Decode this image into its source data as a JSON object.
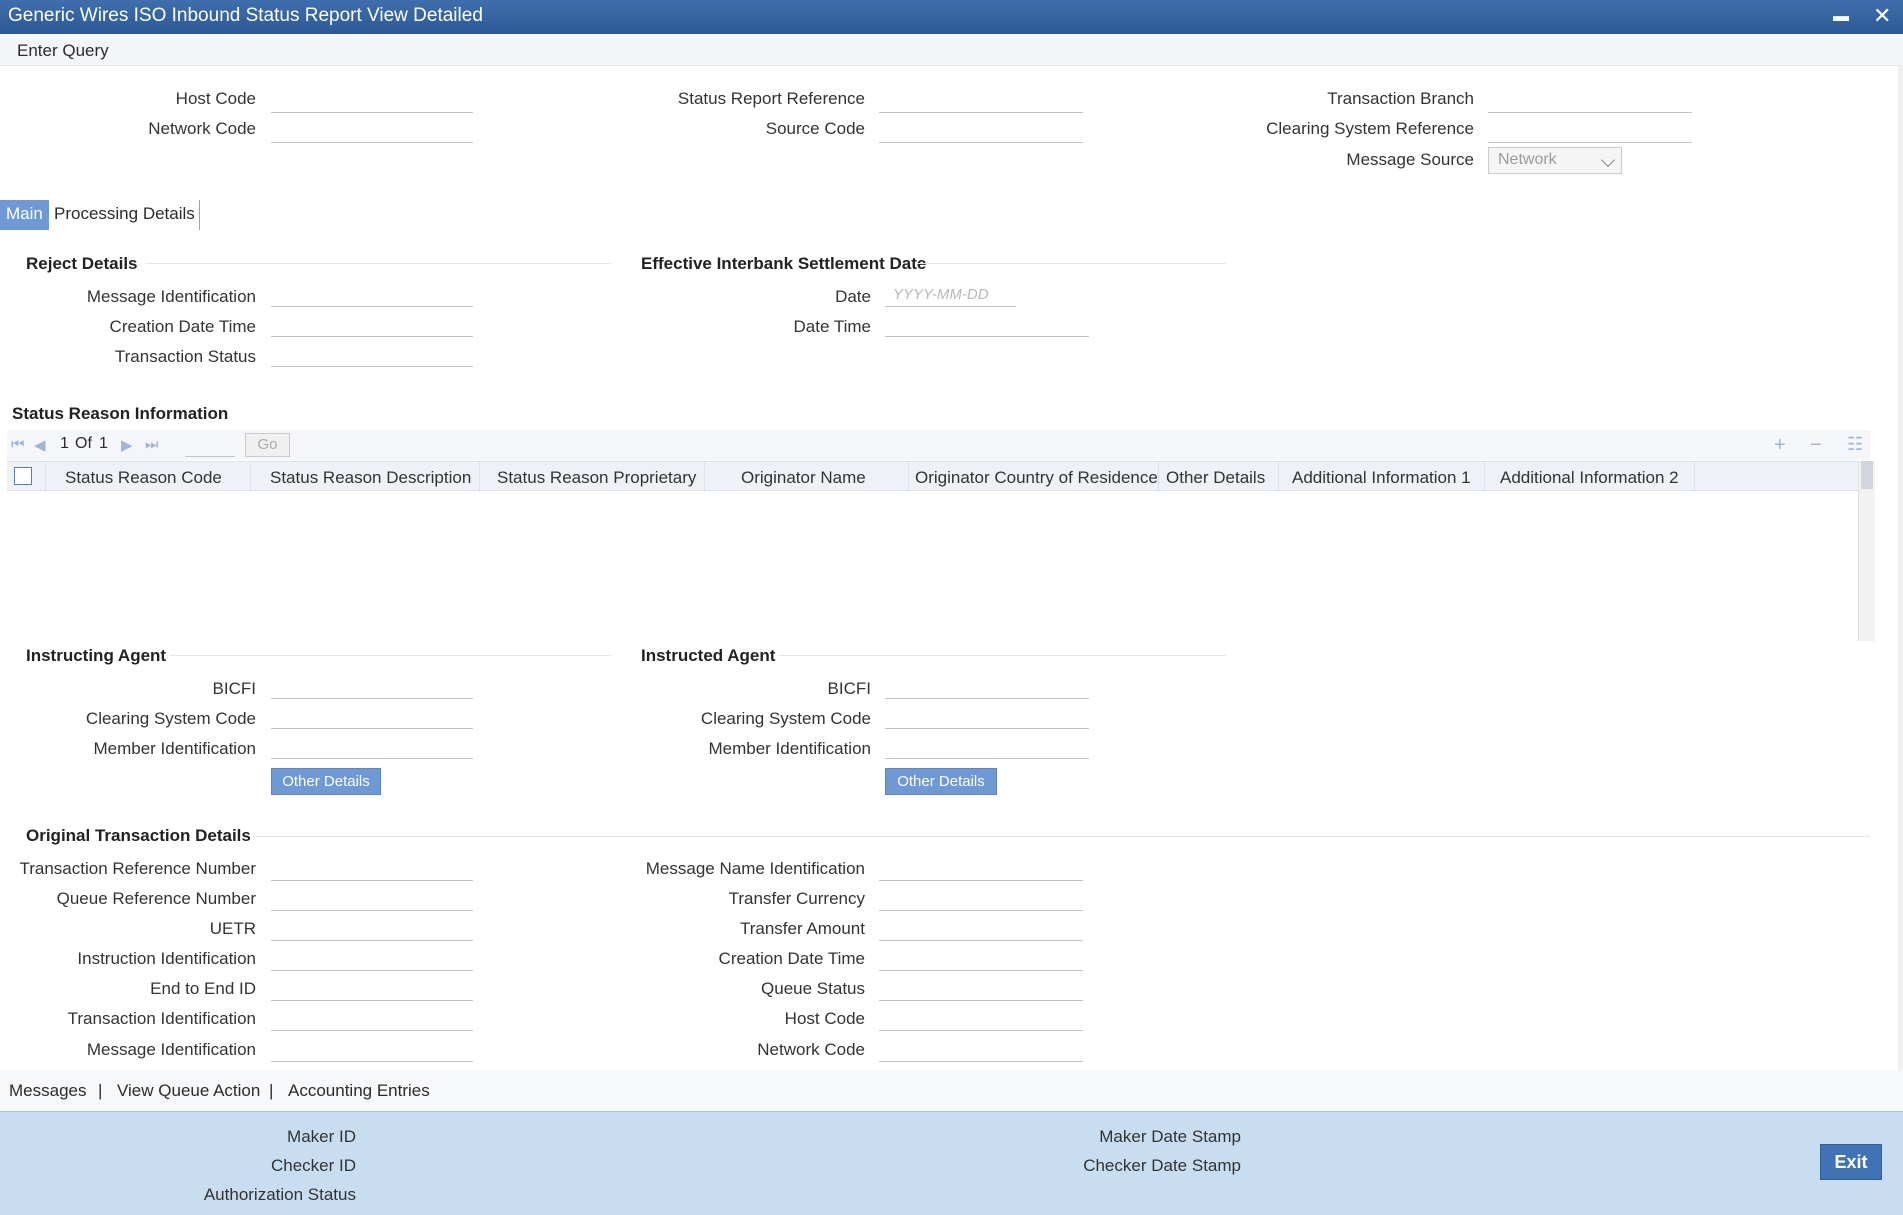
{
  "window": {
    "title": "Generic Wires ISO Inbound Status Report View Detailed",
    "minimize_glyph": "▬",
    "close_glyph": "✕"
  },
  "menu": {
    "enter_query": "Enter Query"
  },
  "header_fields": {
    "host_code": "Host Code",
    "network_code": "Network Code",
    "status_report_reference": "Status Report Reference",
    "source_code": "Source Code",
    "transaction_branch": "Transaction Branch",
    "clearing_system_reference": "Clearing System Reference",
    "message_source": "Message Source",
    "message_source_value": "Network"
  },
  "tabs": [
    {
      "label": "Main",
      "active": true
    },
    {
      "label": "Processing Details",
      "active": false
    }
  ],
  "reject_details": {
    "title": "Reject Details",
    "message_identification": "Message Identification",
    "creation_date_time": "Creation Date Time",
    "transaction_status": "Transaction Status"
  },
  "effective_settlement": {
    "title": "Effective Interbank Settlement Date",
    "date": "Date",
    "date_placeholder": "YYYY-MM-DD",
    "date_time": "Date Time"
  },
  "status_reason": {
    "title": "Status Reason Information",
    "pager": {
      "current": "1",
      "of_label": "Of",
      "total": "1",
      "go": "Go"
    },
    "columns": [
      "Status Reason Code",
      "Status Reason Description",
      "Status Reason Proprietary",
      "Originator Name",
      "Originator Country of Residence",
      "Other Details",
      "Additional Information 1",
      "Additional Information 2"
    ]
  },
  "instructing_agent": {
    "title": "Instructing Agent",
    "bicfi": "BICFI",
    "clearing_system_code": "Clearing System Code",
    "member_identification": "Member Identification",
    "other_details": "Other Details"
  },
  "instructed_agent": {
    "title": "Instructed Agent",
    "bicfi": "BICFI",
    "clearing_system_code": "Clearing System Code",
    "member_identification": "Member Identification",
    "other_details": "Other Details"
  },
  "original_transaction": {
    "title": "Original Transaction Details",
    "left": [
      "Transaction Reference Number",
      "Queue Reference Number",
      "UETR",
      "Instruction Identification",
      "End to End ID",
      "Transaction Identification",
      "Message Identification"
    ],
    "right": [
      "Message Name Identification",
      "Transfer Currency",
      "Transfer Amount",
      "Creation Date Time",
      "Queue Status",
      "Host Code",
      "Network Code"
    ]
  },
  "footer": {
    "links": [
      "Messages",
      "View Queue Action",
      "Accounting Entries"
    ],
    "separator": "|",
    "maker_id": "Maker ID",
    "checker_id": "Checker ID",
    "authorization_status": "Authorization Status",
    "maker_date_stamp": "Maker Date Stamp",
    "checker_date_stamp": "Checker Date Stamp",
    "exit": "Exit"
  },
  "colors": {
    "titlebar": "#2d5a96",
    "tab_active": "#6e99d4",
    "audit_panel": "#c9ddf0",
    "exit_button": "#3f73b6"
  }
}
